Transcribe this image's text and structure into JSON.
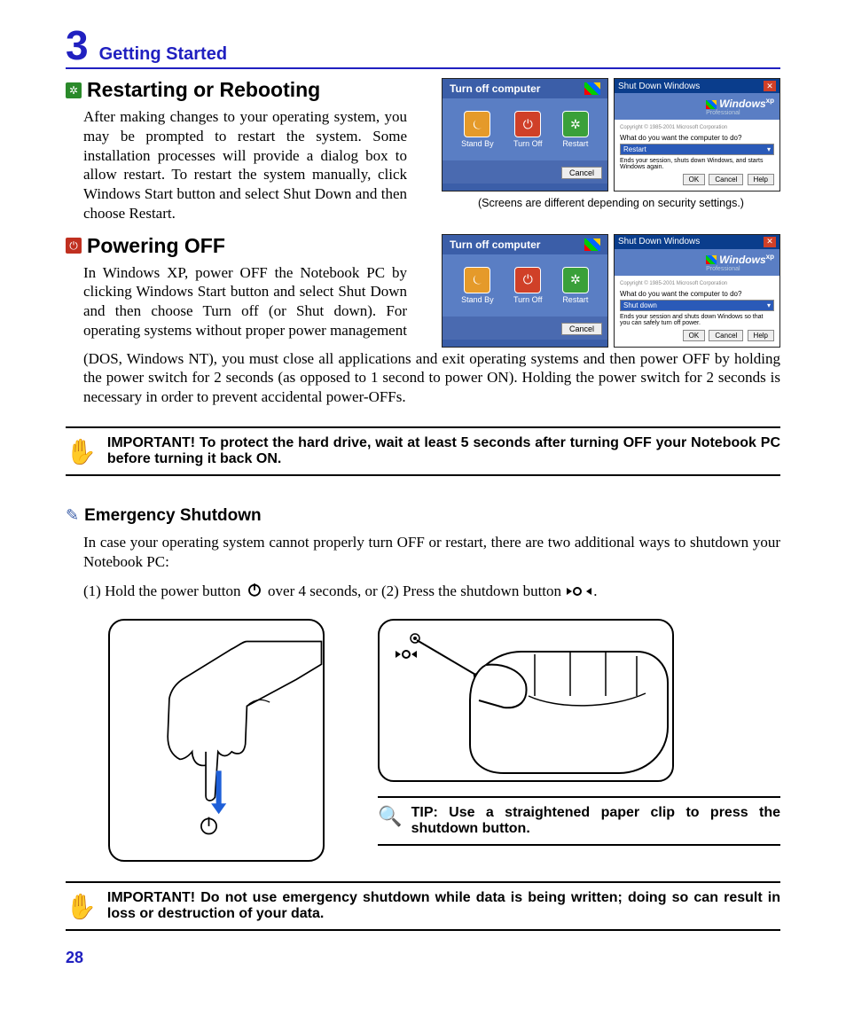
{
  "chapter": {
    "number": "3",
    "title": "Getting Started"
  },
  "section1": {
    "heading": "Restarting or Rebooting",
    "body": "After making changes to your operating system, you may be prompted to restart the system. Some installation processes will provide a dialog box to allow restart. To restart the system manually, click Windows Start button and select Shut Down and then choose Restart.",
    "caption": "(Screens are different depending on security settings.)"
  },
  "section2": {
    "heading": "Powering OFF",
    "body_narrow": "In Windows XP, power OFF the Notebook PC by clicking Windows Start button and select Shut Down and then choose Turn off (or Shut down). For operating systems without proper power management",
    "body_full": "(DOS, Windows NT), you must close all applications and exit operating systems and then power OFF by holding the power switch for 2 seconds (as opposed to 1 second to power ON). Holding the power switch for 2 seconds is necessary in order to prevent accidental power-OFFs."
  },
  "xp": {
    "turnoff_title": "Turn off computer",
    "standby": "Stand By",
    "turnoff": "Turn Off",
    "restart": "Restart",
    "cancel": "Cancel",
    "sd_title": "Shut Down Windows",
    "logo": "Windows",
    "logo_sup": "xp",
    "logo_sub": "Professional",
    "copy": "Copyright © 1985-2001 Microsoft Corporation",
    "question": "What do you want the computer to do?",
    "sel_restart": "Restart",
    "sel_shutdown": "Shut down",
    "desc_restart": "Ends your session, shuts down Windows, and starts Windows again.",
    "desc_shutdown": "Ends your session and shuts down Windows so that you can safely turn off power.",
    "ok": "OK",
    "help": "Help"
  },
  "important1": "IMPORTANT!  To protect the hard drive, wait at least 5 seconds after turning OFF your Notebook PC before turning it back ON.",
  "section3": {
    "heading": "Emergency Shutdown",
    "body": "In case your operating system cannot properly turn OFF or restart, there are two additional ways to shutdown your Notebook PC:",
    "steps_pre": "(1) Hold the power button ",
    "steps_mid": " over 4 seconds, or  (2) Press the shutdown button ",
    "steps_post": "."
  },
  "tip": "TIP: Use a straightened paper clip to press the shutdown button.",
  "important2": "IMPORTANT!  Do not use emergency shutdown while data is being written; doing so can result in loss or destruction of your data.",
  "page_number": "28"
}
